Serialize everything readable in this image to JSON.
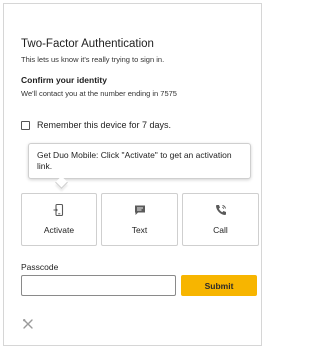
{
  "header": {
    "title": "Two-Factor Authentication",
    "subtitle": "This lets us know it's really trying to sign in."
  },
  "confirm": {
    "heading": "Confirm your identity",
    "description": "We'll contact you at the number ending in 7575"
  },
  "remember": {
    "label": "Remember this device for 7 days.",
    "checked": false
  },
  "tooltip": {
    "text": "Get Duo Mobile: Click \"Activate\" to get an activation link."
  },
  "methods": [
    {
      "label": "Activate",
      "icon": "phone-activate-icon"
    },
    {
      "label": "Text",
      "icon": "chat-bubble-icon"
    },
    {
      "label": "Call",
      "icon": "phone-call-icon"
    }
  ],
  "passcode": {
    "label": "Passcode",
    "value": "",
    "placeholder": ""
  },
  "submit": {
    "label": "Submit"
  },
  "footer": {
    "icon": "tools-icon"
  },
  "colors": {
    "accent": "#f7b500",
    "border": "#cfcfcf",
    "text": "#1f1f1f",
    "icon": "#5a5a5a"
  }
}
